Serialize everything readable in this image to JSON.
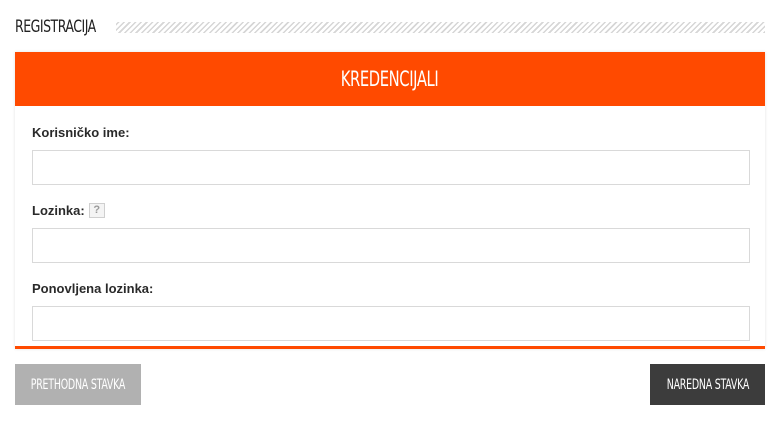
{
  "section": {
    "heading": "REGISTRACIJA"
  },
  "panel": {
    "title": "KREDENCIJALI",
    "fields": [
      {
        "label": "Korisničko ime:",
        "value": "",
        "has_help": false
      },
      {
        "label": "Lozinka:",
        "value": "",
        "has_help": true,
        "help_icon": "?"
      },
      {
        "label": "Ponovljena lozinka:",
        "value": "",
        "has_help": false
      }
    ]
  },
  "buttons": {
    "prev_label": "PRETHODNA STAVKA",
    "next_label": "NAREDNA STAVKA"
  },
  "colors": {
    "accent": "#ff4a00",
    "button_disabled": "#b1b1b1",
    "button_dark": "#3c3c3c"
  }
}
